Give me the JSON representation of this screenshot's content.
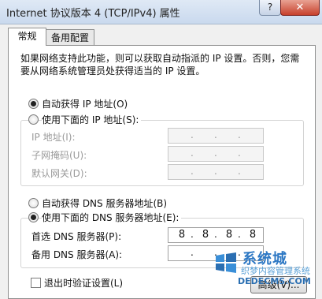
{
  "window": {
    "title": "Internet 协议版本 4 (TCP/IPv4) 属性",
    "help_label": "?",
    "close_label": "✕"
  },
  "tabs": [
    "常规",
    "备用配置"
  ],
  "description": "如果网络支持此功能，则可以获取自动指派的 IP 设置。否则，您需要从网络系统管理员处获得适当的 IP 设置。",
  "ip_mode": {
    "auto_label": "自动获得 IP 地址(O)",
    "manual_label": "使用下面的 IP 地址(S):",
    "selected": "auto"
  },
  "ip_fields": [
    {
      "label": "IP 地址(I):",
      "value": ""
    },
    {
      "label": "子网掩码(U):",
      "value": ""
    },
    {
      "label": "默认网关(D):",
      "value": ""
    }
  ],
  "dns_mode": {
    "auto_label": "自动获得 DNS 服务器地址(B)",
    "manual_label": "使用下面的 DNS 服务器地址(E):",
    "selected": "manual"
  },
  "dns_fields": [
    {
      "label": "首选 DNS 服务器(P):",
      "octets": [
        "8",
        "8",
        "8",
        "8"
      ]
    },
    {
      "label": "备用 DNS 服务器(A):",
      "octets": [
        "",
        "",
        "",
        ""
      ]
    }
  ],
  "validate_on_exit": {
    "label": "退出时验证设置(L)",
    "checked": false
  },
  "advanced_button": "高级(V)...",
  "watermark": {
    "brand": "系统城",
    "sub": "织梦内容管理系统",
    "url": "DEDECMS.COM"
  }
}
